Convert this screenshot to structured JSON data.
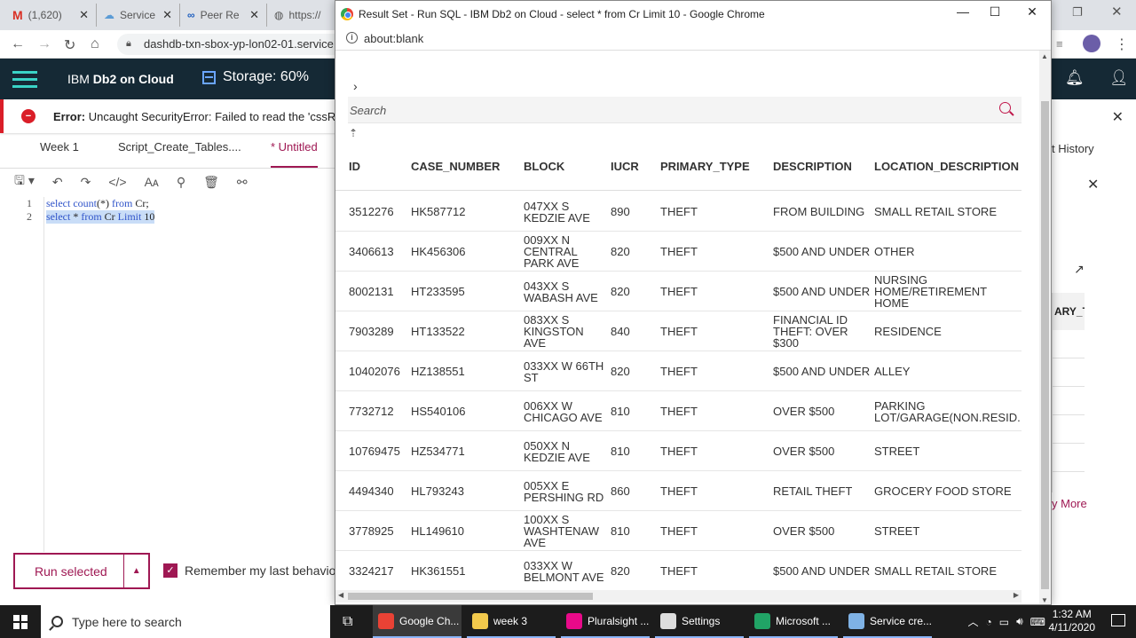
{
  "background_browser": {
    "tabs": [
      {
        "label": "(1,620)",
        "icon": "gmail-icon"
      },
      {
        "label": "Service",
        "icon": "cloud-icon"
      },
      {
        "label": "Peer Re",
        "icon": "infinity-icon"
      },
      {
        "label": "https://",
        "icon": "globe-icon"
      }
    ],
    "url": "dashdb-txn-sbox-yp-lon02-01.service",
    "app_brand_prefix": "IBM ",
    "app_brand_bold": "Db2 on Cloud",
    "storage": "Storage: 60%",
    "error_label": "Error:",
    "error_text": " Uncaught SecurityError: Failed to read the 'cssRu",
    "editor_tabs": [
      "Week 1",
      "Script_Create_Tables....",
      "* Untitled"
    ],
    "code_lines": [
      {
        "num": "1",
        "pre_kw": "select count",
        "mid": "(*) ",
        "kw2": "from",
        "tail": " Cr;"
      },
      {
        "num": "2",
        "pre_kw": "select",
        "mid": " * ",
        "kw2": "from",
        "tail": " Cr ",
        "kw3": "Limit",
        "tail2": " 10"
      }
    ],
    "run_button": "Run selected",
    "remember_label": "Remember my last behavior",
    "right_panel": {
      "history": "t History",
      "col": "ARY_TY",
      "more": "y More"
    }
  },
  "popup": {
    "title": "Result Set - Run SQL - IBM Db2 on Cloud - select * from Cr Limit 10 - Google Chrome",
    "url": "about:blank",
    "search_placeholder": "Search",
    "columns": [
      "ID",
      "CASE_NUMBER",
      "BLOCK",
      "IUCR",
      "PRIMARY_TYPE",
      "DESCRIPTION",
      "LOCATION_DESCRIPTION"
    ],
    "rows": [
      [
        "3512276",
        "HK587712",
        "047XX S KEDZIE AVE",
        "890",
        "THEFT",
        "FROM BUILDING",
        "SMALL RETAIL STORE"
      ],
      [
        "3406613",
        "HK456306",
        "009XX N CENTRAL PARK AVE",
        "820",
        "THEFT",
        "$500 AND UNDER",
        "OTHER"
      ],
      [
        "8002131",
        "HT233595",
        "043XX S WABASH AVE",
        "820",
        "THEFT",
        "$500 AND UNDER",
        "NURSING HOME/RETIREMENT HOME"
      ],
      [
        "7903289",
        "HT133522",
        "083XX S KINGSTON AVE",
        "840",
        "THEFT",
        "FINANCIAL ID THEFT: OVER $300",
        "RESIDENCE"
      ],
      [
        "10402076",
        "HZ138551",
        "033XX W 66TH ST",
        "820",
        "THEFT",
        "$500 AND UNDER",
        "ALLEY"
      ],
      [
        "7732712",
        "HS540106",
        "006XX W CHICAGO AVE",
        "810",
        "THEFT",
        "OVER $500",
        "PARKING LOT/GARAGE(NON.RESID."
      ],
      [
        "10769475",
        "HZ534771",
        "050XX N KEDZIE AVE",
        "810",
        "THEFT",
        "OVER $500",
        "STREET"
      ],
      [
        "4494340",
        "HL793243",
        "005XX E PERSHING RD",
        "860",
        "THEFT",
        "RETAIL THEFT",
        "GROCERY FOOD STORE"
      ],
      [
        "3778925",
        "HL149610",
        "100XX S WASHTENAW AVE",
        "810",
        "THEFT",
        "OVER $500",
        "STREET"
      ],
      [
        "3324217",
        "HK361551",
        "033XX W BELMONT AVE",
        "820",
        "THEFT",
        "$500 AND UNDER",
        "SMALL RETAIL STORE"
      ]
    ]
  },
  "taskbar": {
    "search_placeholder": "Type here to search",
    "apps": [
      {
        "label": "Google Ch...",
        "color": "#e94235"
      },
      {
        "label": "week 3",
        "color": "#f2c94c"
      },
      {
        "label": "Pluralsight ...",
        "color": "#e80a89"
      },
      {
        "label": "Settings",
        "color": "#dddddd"
      },
      {
        "label": "Microsoft ...",
        "color": "#21a366"
      },
      {
        "label": "Service cre...",
        "color": "#7fb2e5"
      }
    ],
    "time": "1:32 AM",
    "date": "4/11/2020"
  },
  "colors": {
    "accent": "#9f1853",
    "header_bg": "#152935",
    "error": "#da1e28"
  }
}
